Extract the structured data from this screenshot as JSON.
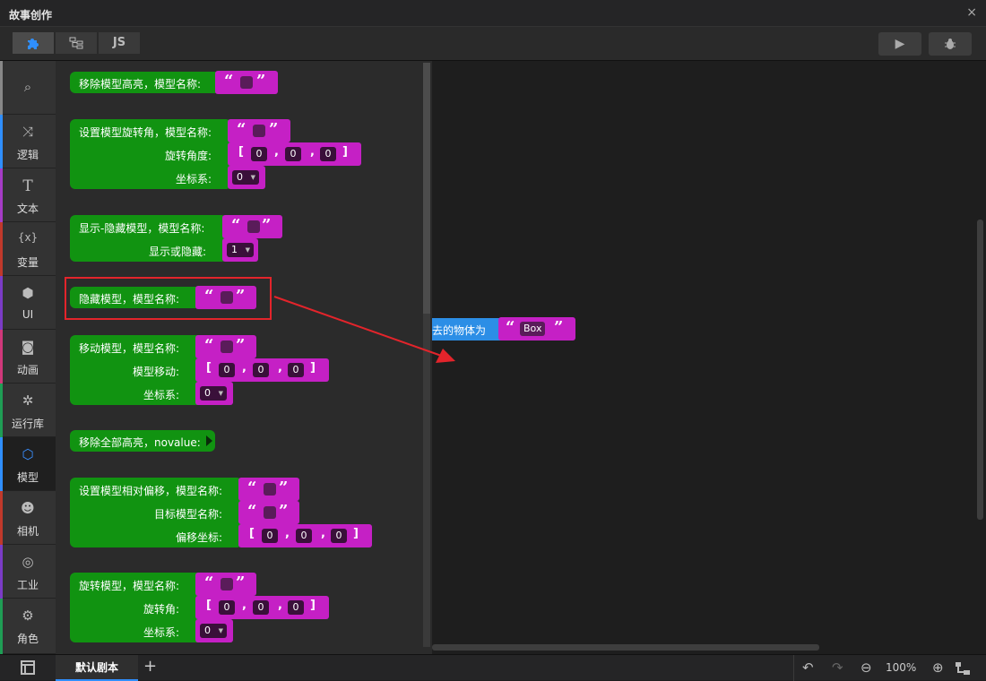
{
  "window": {
    "title": "故事创作",
    "close": "×"
  },
  "toolbar": {
    "tab_blocks_icon": "puzzle-icon",
    "tab_tree_icon": "tree-icon",
    "tab_js": "JS",
    "run_icon": "▶",
    "debug_icon": "bug-icon"
  },
  "nav": [
    {
      "label": "",
      "icon": "⌕",
      "color": "#888888"
    },
    {
      "label": "逻辑",
      "icon": "⤨",
      "color": "#2f8fff"
    },
    {
      "label": "文本",
      "icon": "T",
      "color": "#a63cc6"
    },
    {
      "label": "变量",
      "icon": "{x}",
      "color": "#c0392b"
    },
    {
      "label": "UI",
      "icon": "⬢",
      "color": "#7b3cc6"
    },
    {
      "label": "动画",
      "icon": "◙",
      "color": "#d0387a"
    },
    {
      "label": "运行库",
      "icon": "✲",
      "color": "#1f9d55"
    },
    {
      "label": "模型",
      "icon": "⬡",
      "color": "#2f8fff"
    },
    {
      "label": "相机",
      "icon": "☻",
      "color": "#c0392b"
    },
    {
      "label": "工业",
      "icon": "◎",
      "color": "#7b3cc6"
    },
    {
      "label": "角色",
      "icon": "⚙",
      "color": "#1f9d55"
    }
  ],
  "blocks": {
    "b1": {
      "label": "移除模型高亮，模型名称:"
    },
    "b2": {
      "label": "设置模型旋转角，模型名称:",
      "rot_label": "旋转角度:",
      "rot": [
        "0",
        "0",
        "0"
      ],
      "coord_label": "坐标系:",
      "coord": "0"
    },
    "b3": {
      "label": "显示-隐藏模型，模型名称:",
      "vis_label": "显示或隐藏:",
      "vis": "1"
    },
    "b4": {
      "label": "隐藏模型，模型名称:"
    },
    "b5": {
      "label": "移动模型，模型名称:",
      "move_label": "模型移动:",
      "move": [
        "0",
        "0",
        "0"
      ],
      "coord_label": "坐标系:",
      "coord": "0"
    },
    "b6": {
      "label": "移除全部高亮，novalue:"
    },
    "b7": {
      "label": "设置模型相对偏移，模型名称:",
      "target_label": "目标模型名称:",
      "offset_label": "偏移坐标:",
      "offset": [
        "0",
        "0",
        "0"
      ]
    },
    "b8": {
      "label": "旋转模型，模型名称:",
      "rot_label": "旋转角:",
      "rot": [
        "0",
        "0",
        "0"
      ],
      "coord_label": "坐标系:",
      "coord": "0"
    }
  },
  "workspace": {
    "block_text": "去的物体为",
    "value": "Box"
  },
  "bottom": {
    "script_tab": "默认剧本",
    "add": "+",
    "zoom": "100%"
  },
  "colors": {
    "block_green": "#119311",
    "param_magenta": "#c520c5",
    "highlight": "#e3242b",
    "accent": "#2f8fff"
  }
}
